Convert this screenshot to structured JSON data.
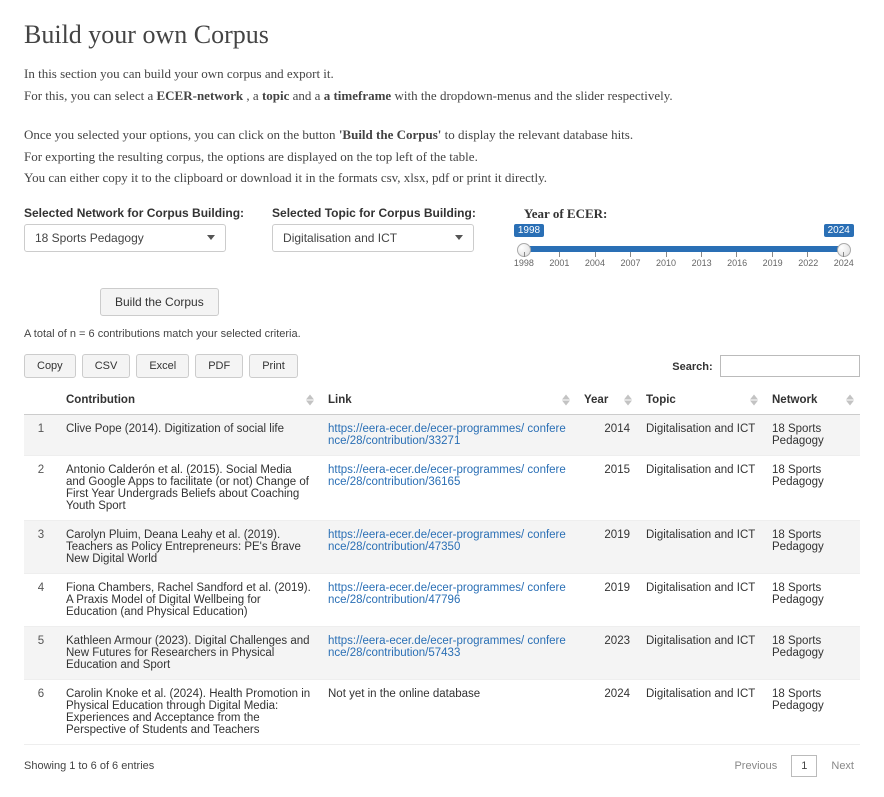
{
  "heading": "Build your own Corpus",
  "intro": {
    "l1": "In this section you can build your own corpus and export it.",
    "l2a": "For this, you can select a ",
    "l2b": "ECER-network",
    "l2c": " , a ",
    "l2d": "topic",
    "l2e": " and a ",
    "l2f": "a timeframe",
    "l2g": " with the dropdown-menus and the slider respectively.",
    "l3a": "Once you selected your options, you can click on the button ",
    "l3b": "'Build the Corpus'",
    "l3c": " to display the relevant database hits.",
    "l4": "For exporting the resulting corpus, the options are displayed on the top left of the table.",
    "l5": "You can either copy it to the clipboard or download it in the formats csv, xlsx, pdf or print it directly."
  },
  "network": {
    "label": "Selected Network for Corpus Building:",
    "value": "18 Sports Pedagogy"
  },
  "topic": {
    "label": "Selected Topic for Corpus Building:",
    "value": "Digitalisation and ICT"
  },
  "slider": {
    "label": "Year of ECER:",
    "min": "1998",
    "max": "2024",
    "ticks": [
      "1998",
      "2001",
      "2004",
      "2007",
      "2010",
      "2013",
      "2016",
      "2019",
      "2022",
      "2024"
    ]
  },
  "build_btn": "Build the Corpus",
  "summary": "A total of n = 6 contributions match your selected criteria.",
  "export": {
    "copy": "Copy",
    "csv": "CSV",
    "excel": "Excel",
    "pdf": "PDF",
    "print": "Print"
  },
  "search": {
    "label": "Search:",
    "value": ""
  },
  "columns": {
    "contribution": "Contribution",
    "link": "Link",
    "year": "Year",
    "topic": "Topic",
    "network": "Network"
  },
  "rows": [
    {
      "idx": "1",
      "contribution": "Clive Pope (2014). Digitization of social life",
      "link": "https://eera-ecer.de/ecer-programmes/ conference/28/contribution/33271",
      "year": "2014",
      "topic": "Digitalisation and ICT",
      "network": "18 Sports Pedagogy"
    },
    {
      "idx": "2",
      "contribution": "Antonio Calderón et al. (2015). Social Media and Google Apps to facilitate (or not) Change of First Year Undergrads Beliefs about Coaching Youth Sport",
      "link": "https://eera-ecer.de/ecer-programmes/ conference/28/contribution/36165",
      "year": "2015",
      "topic": "Digitalisation and ICT",
      "network": "18 Sports Pedagogy"
    },
    {
      "idx": "3",
      "contribution": "Carolyn Pluim, Deana Leahy et al. (2019). Teachers as Policy Entrepreneurs: PE's Brave New Digital World",
      "link": "https://eera-ecer.de/ecer-programmes/ conference/28/contribution/47350",
      "year": "2019",
      "topic": "Digitalisation and ICT",
      "network": "18 Sports Pedagogy"
    },
    {
      "idx": "4",
      "contribution": "Fiona Chambers, Rachel Sandford et al. (2019). A Praxis Model of Digital Wellbeing for Education (and Physical Education)",
      "link": "https://eera-ecer.de/ecer-programmes/ conference/28/contribution/47796",
      "year": "2019",
      "topic": "Digitalisation and ICT",
      "network": "18 Sports Pedagogy"
    },
    {
      "idx": "5",
      "contribution": "Kathleen Armour (2023). Digital Challenges and New Futures for Researchers in Physical Education and Sport",
      "link": "https://eera-ecer.de/ecer-programmes/ conference/28/contribution/57433",
      "year": "2023",
      "topic": "Digitalisation and ICT",
      "network": "18 Sports Pedagogy"
    },
    {
      "idx": "6",
      "contribution": "Carolin Knoke et al. (2024). Health Promotion in Physical Education through Digital Media: Experiences and Acceptance from the Perspective of Students and Teachers",
      "link": "Not yet in the online database",
      "year": "2024",
      "topic": "Digitalisation and ICT",
      "network": "18 Sports Pedagogy"
    }
  ],
  "footer": {
    "info": "Showing 1 to 6 of 6 entries",
    "prev": "Previous",
    "page": "1",
    "next": "Next"
  }
}
